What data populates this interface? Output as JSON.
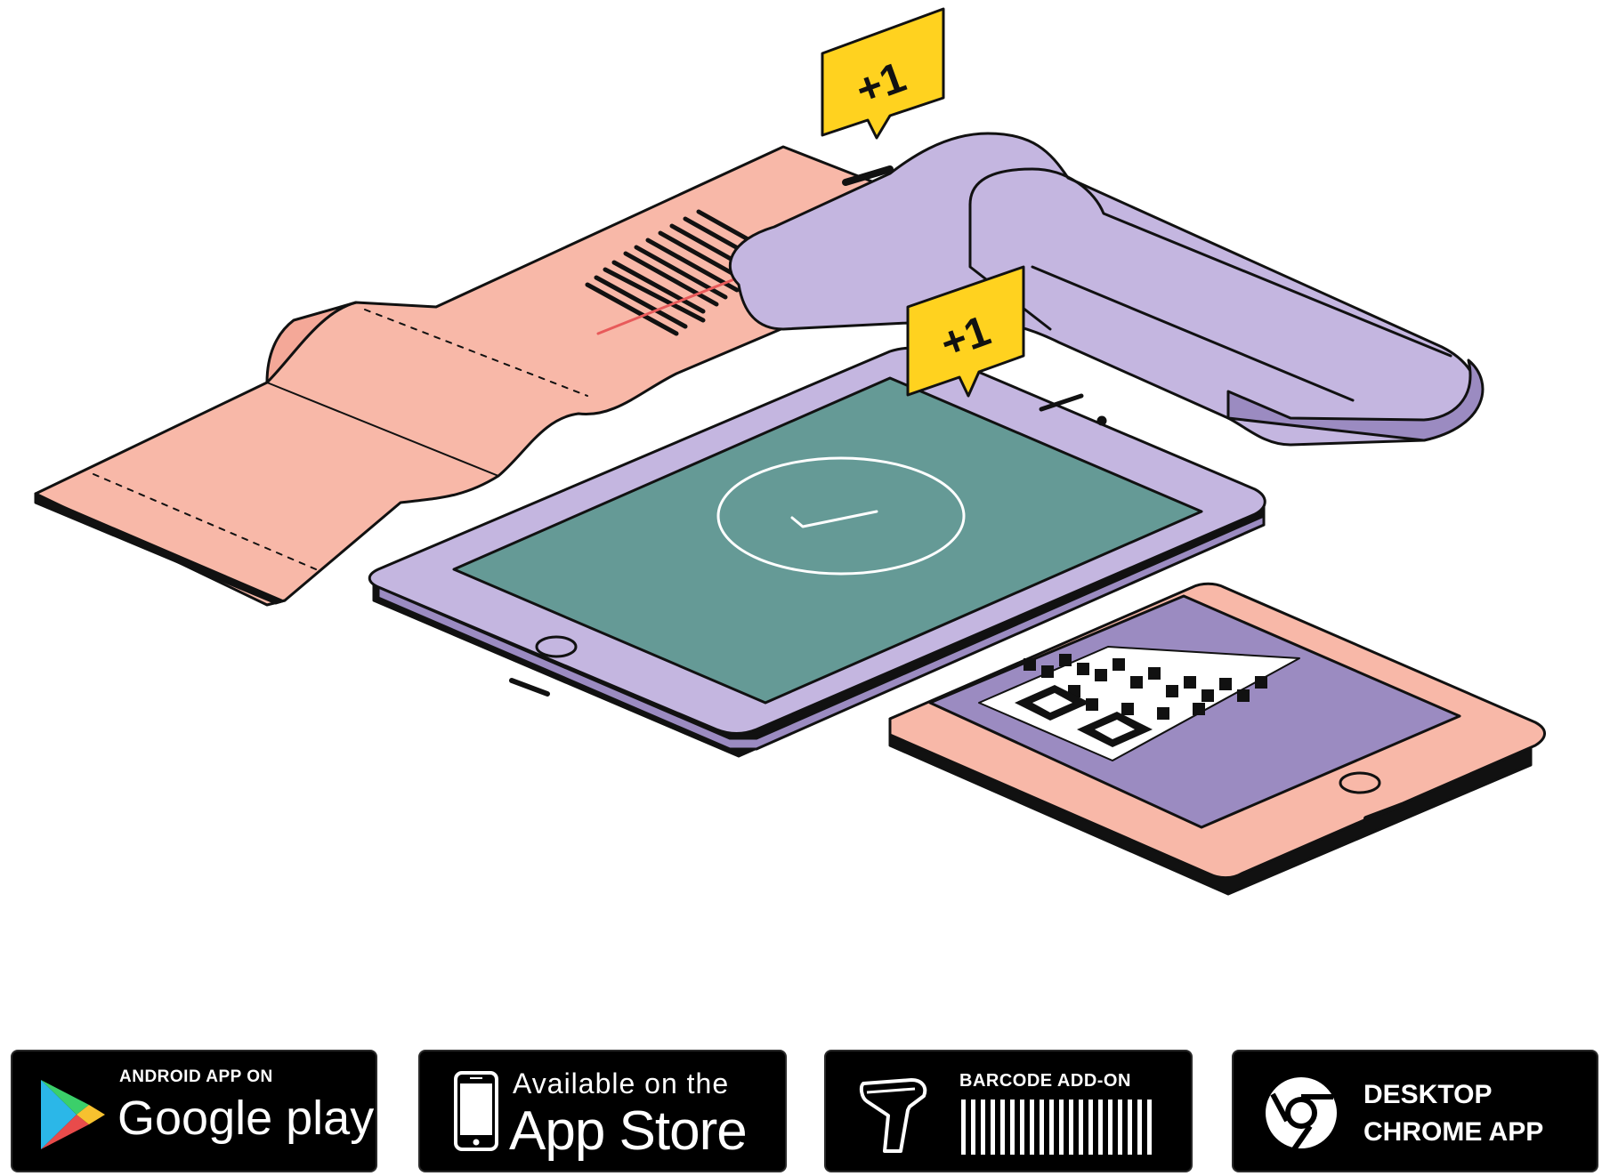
{
  "illustration": {
    "notifications": [
      {
        "text": "+1"
      },
      {
        "text": "+1"
      }
    ],
    "colors": {
      "scanner": "#c4b6e0",
      "scanner_shadow": "#9b8bc1",
      "receipt": "#f8b8a8",
      "tablet_frame": "#c4b6e0",
      "tablet_screen": "#659a96",
      "phone_frame": "#f8b8a8",
      "phone_screen": "#9b8bc1",
      "bubble": "#ffd21f",
      "outline": "#111111"
    }
  },
  "badges": [
    {
      "id": "google-play",
      "top_text": "ANDROID APP ON",
      "main_text": "Google play",
      "icon": "google-play-icon"
    },
    {
      "id": "app-store",
      "top_text": "Available on the",
      "main_text": "App Store",
      "icon": "phone-icon"
    },
    {
      "id": "barcode-addon",
      "top_text": "BARCODE ADD-ON",
      "icon": "barcode-scanner-icon"
    },
    {
      "id": "chrome-app",
      "line1": "DESKTOP",
      "line2": "CHROME APP",
      "icon": "chrome-icon"
    }
  ]
}
